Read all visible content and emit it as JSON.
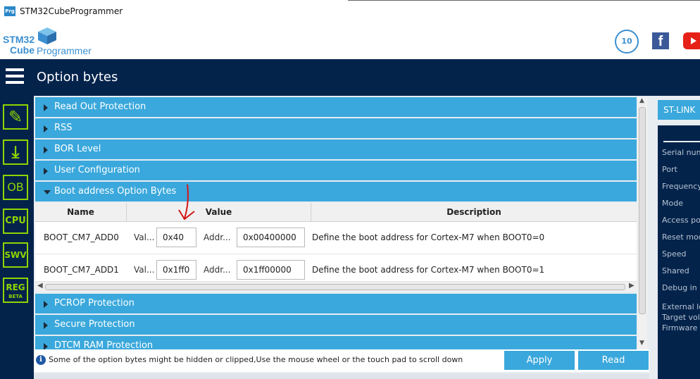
{
  "window": {
    "app_icon_text": "Prg",
    "title": "STM32CubeProgrammer"
  },
  "logo": {
    "line1": "STM32",
    "line2": "Cube",
    "line3": "Programmer"
  },
  "header": {
    "badge_text": "10",
    "facebook_text": "f"
  },
  "nav": {
    "title": "Option bytes"
  },
  "sidebar": {
    "items": [
      {
        "label": "✎",
        "icon": "edit-icon"
      },
      {
        "label": "⤓",
        "icon": "download-icon"
      },
      {
        "label": "OB",
        "icon": "ob-icon"
      },
      {
        "label": "CPU",
        "icon": "cpu-icon"
      },
      {
        "label": "SWV",
        "icon": "swv-icon"
      },
      {
        "label": "REG",
        "sub": "BETA",
        "icon": "reg-icon"
      }
    ]
  },
  "sections": [
    {
      "label": "Read Out Protection",
      "expanded": false
    },
    {
      "label": "RSS",
      "expanded": false
    },
    {
      "label": "BOR Level",
      "expanded": false
    },
    {
      "label": "User Configuration",
      "expanded": false
    },
    {
      "label": "Boot address Option Bytes",
      "expanded": true
    },
    {
      "label": "PCROP Protection",
      "expanded": false
    },
    {
      "label": "Secure Protection",
      "expanded": false
    },
    {
      "label": "DTCM RAM Protection",
      "expanded": false
    }
  ],
  "table": {
    "headers": {
      "name": "Name",
      "value": "Value",
      "description": "Description"
    },
    "rows": [
      {
        "name": "BOOT_CM7_ADD0",
        "val_label": "Val...",
        "val": "0x40",
        "addr_label": "Addr...",
        "addr": "0x00400000",
        "description": "Define the boot address for Cortex-M7 when BOOT0=0"
      },
      {
        "name": "BOOT_CM7_ADD1",
        "val_label": "Val...",
        "val": "0x1ff0",
        "addr_label": "Addr...",
        "addr": "0x1ff00000",
        "description": "Define the boot address for Cortex-M7 when BOOT0=1"
      }
    ]
  },
  "info": {
    "message": "Some of the option bytes might be hidden or clipped,Use the mouse wheel or the touch pad to scroll down"
  },
  "buttons": {
    "apply": "Apply",
    "read": "Read"
  },
  "right_panel": {
    "tab": "ST-LINK",
    "labels": [
      "Serial num",
      "Port",
      "Frequency",
      "Mode",
      "Access po",
      "Reset mod",
      "Speed",
      "Shared",
      "Debug in",
      "External lo",
      "Target vol",
      "Firmware v"
    ]
  },
  "colors": {
    "accent": "#3aa8dc",
    "navy": "#03234b",
    "green": "#8fd400"
  }
}
